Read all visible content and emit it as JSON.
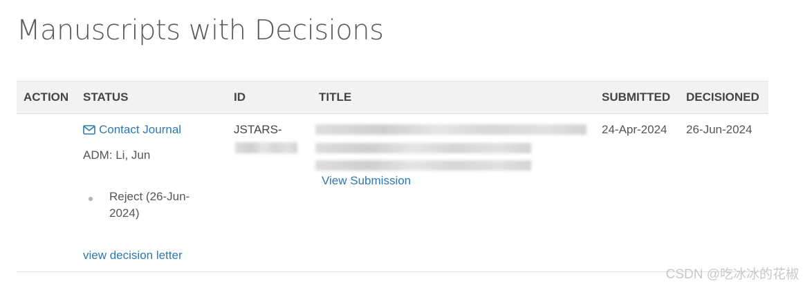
{
  "page": {
    "title": "Manuscripts with Decisions"
  },
  "table": {
    "headers": {
      "action": "ACTION",
      "status": "STATUS",
      "id": "ID",
      "title": "TITLE",
      "submitted": "SUBMITTED",
      "decisioned": "DECISIONED"
    },
    "rows": [
      {
        "contact_label": "Contact Journal",
        "admin": "ADM: Li, Jun",
        "status_item": "Reject (26-Jun-2024)",
        "decision_letter_label": "view decision letter",
        "id_prefix": "JSTARS-",
        "view_submission_label": "View Submission",
        "submitted": "24-Apr-2024",
        "decisioned": "26-Jun-2024"
      }
    ]
  },
  "watermark": "CSDN @吃冰冰的花椒",
  "colors": {
    "link": "#2b78b4",
    "header_bg": "#f2f2f2",
    "text": "#444444"
  }
}
